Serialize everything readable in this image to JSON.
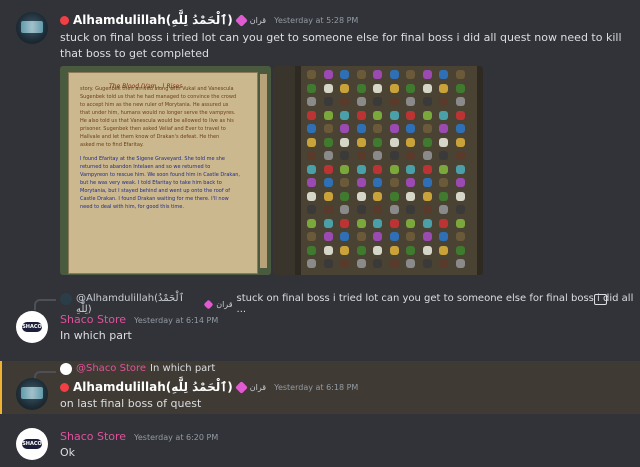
{
  "messages": [
    {
      "author": "Alhamdulillah(ٱلْحَمْدُ لِلَّٰهِ)",
      "server_tag": "قران",
      "timestamp": "Yesterday at 5:28 PM",
      "text_line1": "stuck on final boss i tried lot can you get to someone else for final boss i did all quest now need to kill",
      "text_line2": "that boss to get completed",
      "attachments": [
        {
          "kind": "quest-journal-screenshot",
          "journal_title": "The Blood (Vam...) Rises",
          "journal_lines": [
            "story. Gugenbek then arrived along with Vukal and Vanescula",
            "Sugenbek told us that he had managed to convince the crowd",
            "to accept him as the new ruler of Morytania. He assured us",
            "that under him, humans would no longer serve the vampyres.",
            "He also told us that Vanescula would be allowed to live as his",
            "prisoner. Sugenbek then asked Veliaf and Ever to travel to",
            "Hallvale and let them know of Drakan's defeat. He then",
            "asked me to find Efaritay.",
            "I found Efaritay at the Sigene Graveyard. She told me she",
            "returned to abandon Intelaen and so we returned to",
            "Vampyreon to rescue him. We soon found him in Castle Drakan,",
            "but he was very weak. I told Efaritay to take him back to",
            "Morytania, but I stayed behind and went up onto the roof of",
            "Castle Drakan. I found Drakan waiting for me there. I'll now",
            "need to deal with him, for good this time."
          ]
        },
        {
          "kind": "bank-inventory-screenshot"
        }
      ]
    },
    {
      "reply_to": {
        "author": "@Alhamdulillah(ٱلْحَمْدُ لِلَّٰهِ)",
        "server_tag": "قران",
        "text": "stuck on final boss i tried lot can you get to someone else for final boss i did all ..."
      },
      "author": "Shaco Store",
      "timestamp": "Yesterday at 6:14 PM",
      "text": "In which part"
    },
    {
      "reply_to": {
        "author": "@Shaco Store",
        "text": "In which part"
      },
      "author": "Alhamdulillah(ٱلْحَمْدُ لِلَّٰهِ)",
      "server_tag": "قران",
      "timestamp": "Yesterday at 6:18 PM",
      "text": "on last final boss of quest"
    },
    {
      "author": "Shaco Store",
      "timestamp": "Yesterday at 6:20 PM",
      "text": "Ok"
    }
  ],
  "avatar_text": {
    "shaco": "SHACO"
  },
  "colors": {
    "background": "#313338",
    "mention_highlight": "#3f3a33",
    "mention_bar": "#f0b232",
    "shaco_name": "#e0529c",
    "timestamp": "#949ba4"
  },
  "icons": [
    "server-tag-icon",
    "gem-badge-icon",
    "image-icon"
  ]
}
